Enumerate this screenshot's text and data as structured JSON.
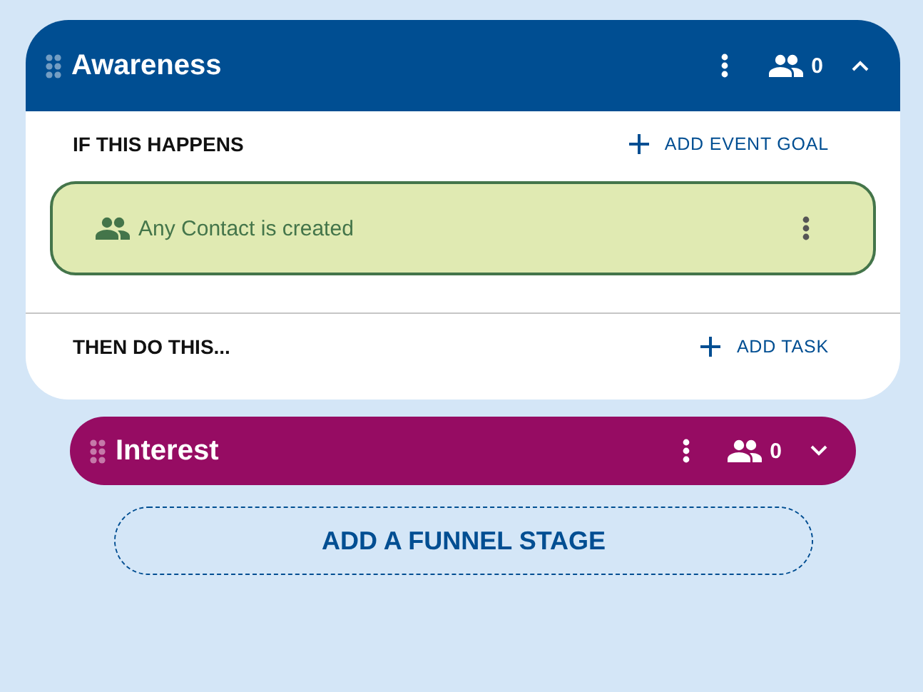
{
  "stages": [
    {
      "title": "Awareness",
      "color": "#004e92",
      "contacts": "0",
      "expanded": true,
      "sections": [
        {
          "heading": "IF THIS HAPPENS",
          "action": "ADD EVENT GOAL",
          "items": [
            {
              "text": "Any Contact is created"
            }
          ]
        },
        {
          "heading": "THEN DO THIS...",
          "action": "ADD TASK"
        }
      ]
    },
    {
      "title": "Interest",
      "color": "#960c63",
      "contacts": "0",
      "expanded": false
    }
  ],
  "add_stage_button": "ADD A FUNNEL STAGE"
}
